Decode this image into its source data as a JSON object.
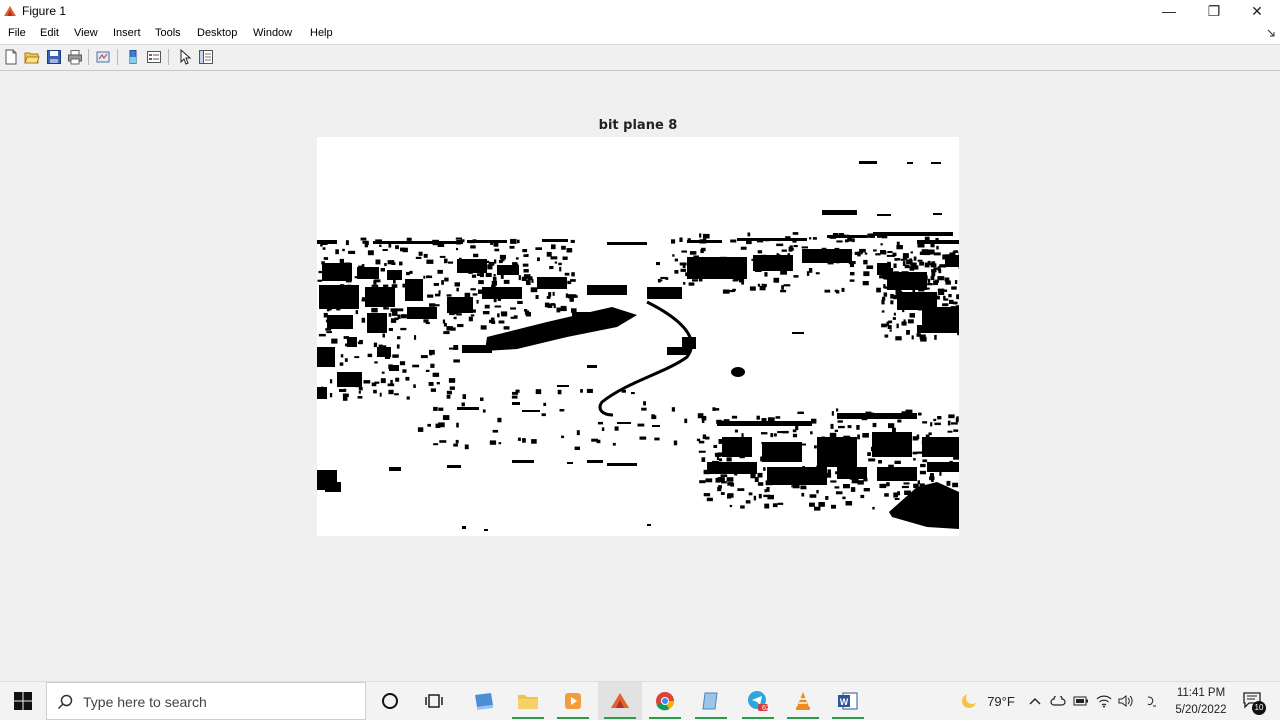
{
  "window": {
    "title": "Figure 1",
    "controls": {
      "minimize": "—",
      "restore": "❐",
      "close": "✕"
    }
  },
  "menu": [
    "File",
    "Edit",
    "View",
    "Insert",
    "Tools",
    "Desktop",
    "Window",
    "Help"
  ],
  "toolbar": {
    "buttons": [
      "new-figure",
      "open-file",
      "save",
      "print",
      "link-plot",
      "insert-colorbar",
      "insert-legend",
      "edit-plot",
      "property-inspector"
    ]
  },
  "figure": {
    "title": "bit plane 8",
    "colors": {
      "background": "#f0f0f0",
      "image_foreground": "#000000",
      "image_background": "#ffffff"
    }
  },
  "taskbar": {
    "search_placeholder": "Type here to search",
    "apps": [
      "task-view",
      "windows-explorer-preview",
      "file-explorer",
      "media-player",
      "matlab",
      "chrome",
      "notepad-like",
      "telegram",
      "vlc",
      "word"
    ],
    "telegram_badge": "62",
    "weather": "79°F",
    "time": "11:41 PM",
    "date": "5/20/2022",
    "notifications": "10"
  }
}
